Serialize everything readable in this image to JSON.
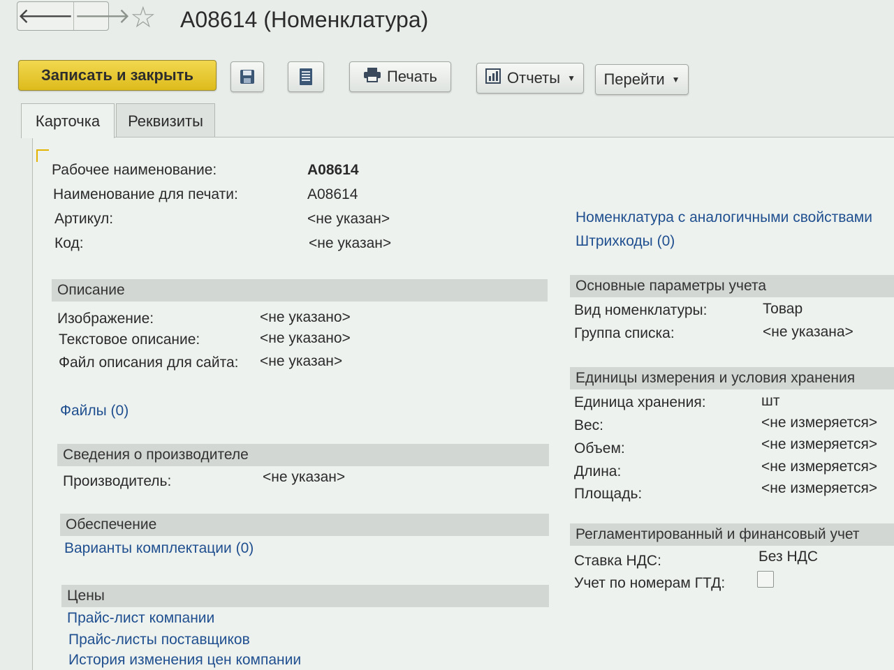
{
  "window": {
    "title": "A08614 (Номенклатура)"
  },
  "nav": {
    "back": "🡐",
    "forward": "🡒",
    "star": "☆"
  },
  "toolbar": {
    "save_close": "Записать и закрыть",
    "print": "Печать",
    "reports": "Отчеты",
    "goto": "Перейти"
  },
  "tabs": {
    "card": "Карточка",
    "requisites": "Реквизиты"
  },
  "main": {
    "work_name_label": "Рабочее наименование:",
    "work_name_value": "A08614",
    "print_name_label": "Наименование для печати:",
    "print_name_value": "A08614",
    "article_label": "Артикул:",
    "article_value": "<не указан>",
    "code_label": "Код:",
    "code_value": "<не указан>"
  },
  "right_links": {
    "analog": "Номенклатура с аналогичными свойствами",
    "barcodes": "Штрихкоды (0)"
  },
  "description": {
    "header": "Описание",
    "image_label": "Изображение:",
    "image_value": "<не указано>",
    "text_label": "Текстовое описание:",
    "text_value": "<не указано>",
    "file_label": "Файл описания для сайта:",
    "file_value": "<не указан>",
    "files_link": "Файлы (0)"
  },
  "manufacturer": {
    "header": "Сведения о производителе",
    "label": "Производитель:",
    "value": "<не указан>"
  },
  "supply": {
    "header": "Обеспечение",
    "link": "Варианты комплектации (0)"
  },
  "prices": {
    "header": "Цены",
    "links": [
      "Прайс-лист компании",
      "Прайс-листы поставщиков",
      "История изменения цен компании"
    ]
  },
  "accounting": {
    "header": "Основные параметры учета",
    "type_label": "Вид номенклатуры:",
    "type_value": "Товар",
    "group_label": "Группа списка:",
    "group_value": "<не указана>"
  },
  "units": {
    "header": "Единицы измерения и условия хранения",
    "storage_label": "Единица хранения:",
    "storage_value": "шт",
    "weight_label": "Вес:",
    "weight_value": "<не измеряется>",
    "volume_label": "Объем:",
    "volume_value": "<не измеряется>",
    "length_label": "Длина:",
    "length_value": "<не измеряется>",
    "area_label": "Площадь:",
    "area_value": "<не измеряется>"
  },
  "regulated": {
    "header": "Регламентированный и финансовый учет",
    "vat_label": "Ставка НДС:",
    "vat_value": "Без НДС",
    "gtd_label": "Учет по номерам ГТД:",
    "gtd_checked": false
  }
}
